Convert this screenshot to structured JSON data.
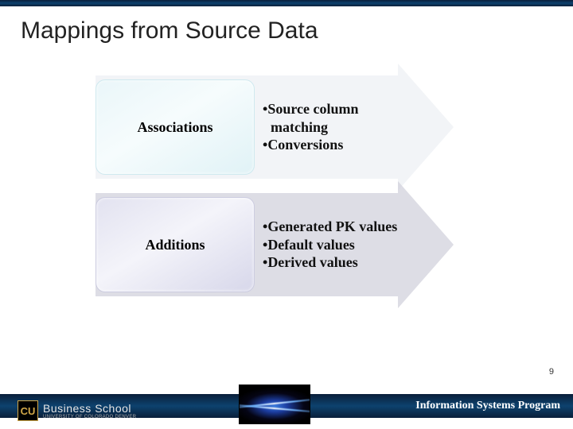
{
  "title": "Mappings from Source Data",
  "blocks": [
    {
      "label": "Associations",
      "bullets": [
        "Source column matching",
        "Conversions"
      ]
    },
    {
      "label": "Additions",
      "bullets": [
        "Generated PK values",
        "Default values",
        "Derived values"
      ]
    }
  ],
  "page_number": "9",
  "footer": {
    "program": "Information Systems Program",
    "logo_mark": "CU",
    "logo_line1": "Business School",
    "logo_line2": "UNIVERSITY OF COLORADO DENVER"
  }
}
